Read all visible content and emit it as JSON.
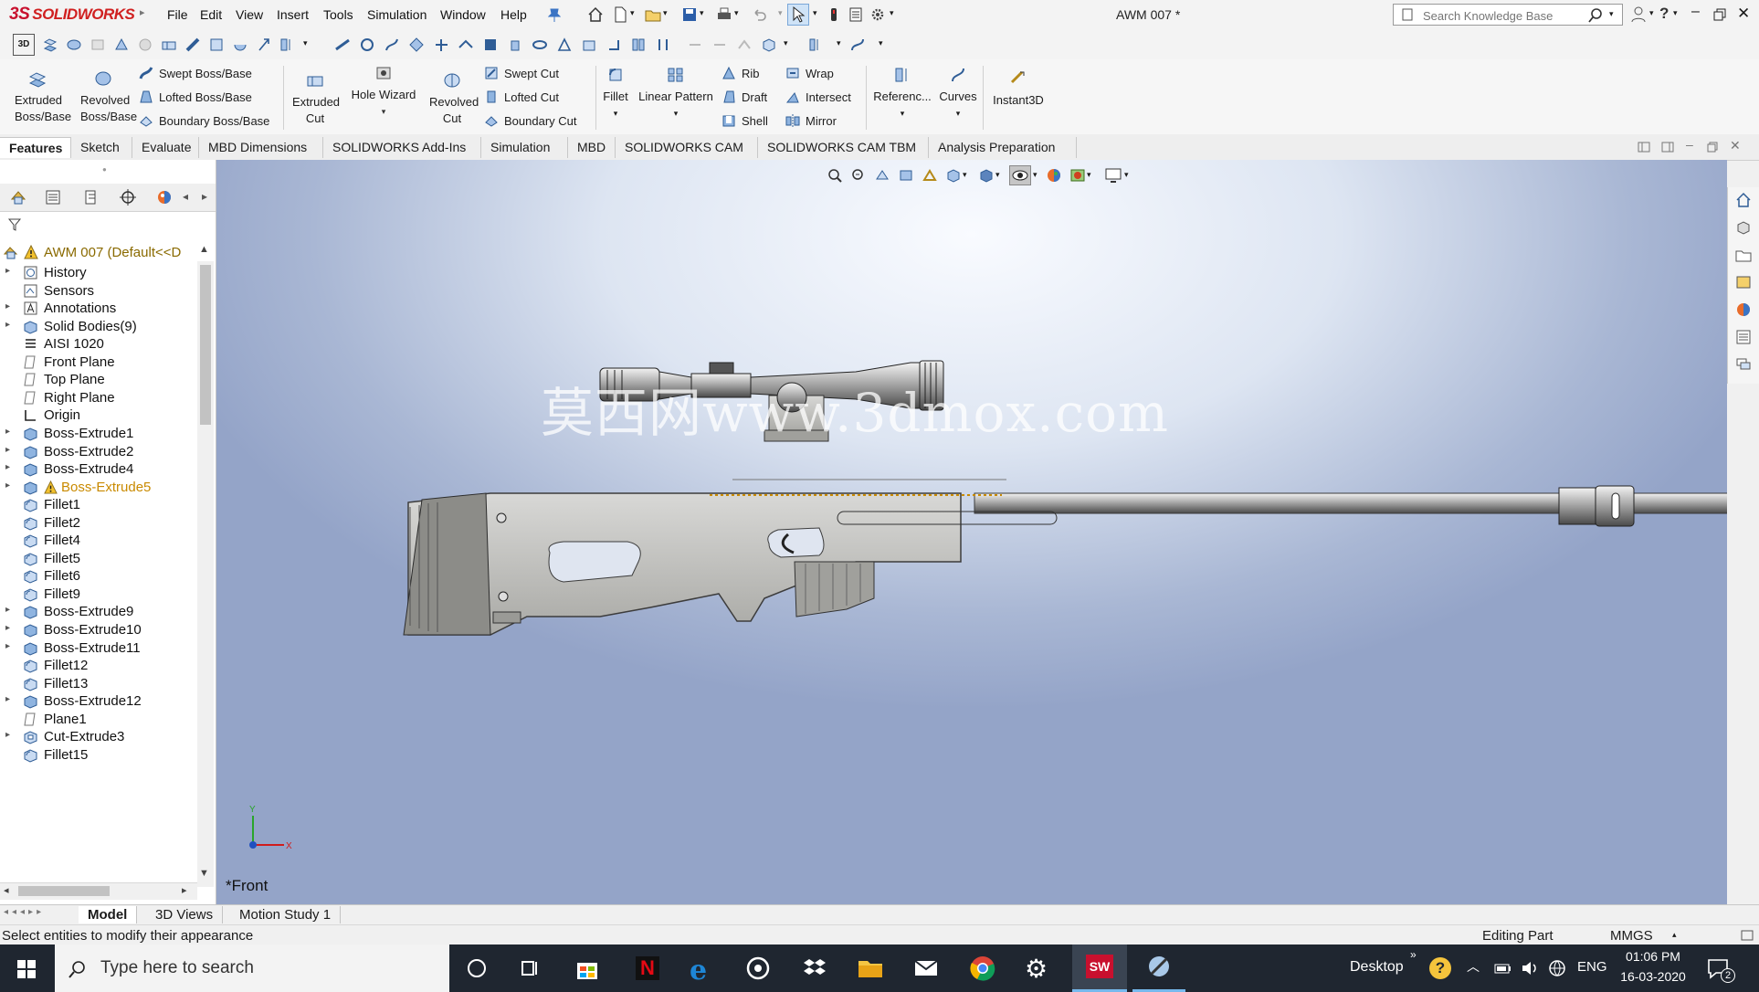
{
  "app": {
    "logo_text": "SOLIDWORKS",
    "logo_symbol": "3S",
    "document_title": "AWM 007 *"
  },
  "menu": [
    "File",
    "Edit",
    "View",
    "Insert",
    "Tools",
    "Simulation",
    "Window",
    "Help"
  ],
  "search": {
    "placeholder": "Search Knowledge Base"
  },
  "command_manager": {
    "extruded_boss": "Extruded Boss/Base",
    "revolved_boss": "Revolved Boss/Base",
    "swept_boss": "Swept Boss/Base",
    "lofted_boss": "Lofted Boss/Base",
    "boundary_boss": "Boundary Boss/Base",
    "extruded_cut": "Extruded Cut",
    "hole_wizard": "Hole Wizard",
    "revolved_cut": "Revolved Cut",
    "swept_cut": "Swept Cut",
    "lofted_cut": "Lofted Cut",
    "boundary_cut": "Boundary Cut",
    "fillet": "Fillet",
    "linear_pattern": "Linear Pattern",
    "rib": "Rib",
    "draft": "Draft",
    "shell": "Shell",
    "wrap": "Wrap",
    "intersect": "Intersect",
    "mirror": "Mirror",
    "reference": "Referenc...",
    "curves": "Curves",
    "instant3d": "Instant3D"
  },
  "tabs": [
    "Features",
    "Sketch",
    "Evaluate",
    "MBD Dimensions",
    "SOLIDWORKS Add-Ins",
    "Simulation",
    "MBD",
    "SOLIDWORKS CAM",
    "SOLIDWORKS CAM TBM",
    "Analysis Preparation"
  ],
  "feature_tree": {
    "root": "AWM 007  (Default<<D",
    "items": [
      {
        "label": "History",
        "icon": "history-icon",
        "expandable": true
      },
      {
        "label": "Sensors",
        "icon": "sensors-icon",
        "expandable": false
      },
      {
        "label": "Annotations",
        "icon": "annotations-icon",
        "expandable": true
      },
      {
        "label": "Solid Bodies(9)",
        "icon": "solid-bodies-icon",
        "expandable": true
      },
      {
        "label": "AISI 1020",
        "icon": "material-icon",
        "expandable": false
      },
      {
        "label": "Front Plane",
        "icon": "plane-icon",
        "expandable": false
      },
      {
        "label": "Top Plane",
        "icon": "plane-icon",
        "expandable": false
      },
      {
        "label": "Right Plane",
        "icon": "plane-icon",
        "expandable": false
      },
      {
        "label": "Origin",
        "icon": "origin-icon",
        "expandable": false
      },
      {
        "label": "Boss-Extrude1",
        "icon": "extrude-icon",
        "expandable": true
      },
      {
        "label": "Boss-Extrude2",
        "icon": "extrude-icon",
        "expandable": true
      },
      {
        "label": "Boss-Extrude4",
        "icon": "extrude-icon",
        "expandable": true
      },
      {
        "label": "Boss-Extrude5",
        "icon": "extrude-icon",
        "expandable": true,
        "warning": true
      },
      {
        "label": "Fillet1",
        "icon": "fillet-icon",
        "expandable": false
      },
      {
        "label": "Fillet2",
        "icon": "fillet-icon",
        "expandable": false
      },
      {
        "label": "Fillet4",
        "icon": "fillet-icon",
        "expandable": false
      },
      {
        "label": "Fillet5",
        "icon": "fillet-icon",
        "expandable": false
      },
      {
        "label": "Fillet6",
        "icon": "fillet-icon",
        "expandable": false
      },
      {
        "label": "Fillet9",
        "icon": "fillet-icon",
        "expandable": false
      },
      {
        "label": "Boss-Extrude9",
        "icon": "extrude-icon",
        "expandable": true
      },
      {
        "label": "Boss-Extrude10",
        "icon": "extrude-icon",
        "expandable": true
      },
      {
        "label": "Boss-Extrude11",
        "icon": "extrude-icon",
        "expandable": true
      },
      {
        "label": "Fillet12",
        "icon": "fillet-icon",
        "expandable": false
      },
      {
        "label": "Fillet13",
        "icon": "fillet-icon",
        "expandable": false
      },
      {
        "label": "Boss-Extrude12",
        "icon": "extrude-icon",
        "expandable": true
      },
      {
        "label": "Plane1",
        "icon": "plane-icon",
        "expandable": false
      },
      {
        "label": "Cut-Extrude3",
        "icon": "cut-extrude-icon",
        "expandable": true
      },
      {
        "label": "Fillet15",
        "icon": "fillet-icon",
        "expandable": false
      }
    ]
  },
  "viewport": {
    "view_label": "*Front",
    "watermark": "莫西网www.3dmox.com",
    "axis_y": "Y",
    "axis_x": "X"
  },
  "bottom_tabs": [
    "Model",
    "3D Views",
    "Motion Study 1"
  ],
  "status": {
    "message": "Select entities to modify their appearance",
    "mode": "Editing Part",
    "units": "MMGS"
  },
  "taskbar": {
    "search_placeholder": "Type here to search",
    "desktop": "Desktop",
    "language": "ENG",
    "time": "01:06 PM",
    "date": "16-03-2020",
    "notifications": "2"
  },
  "colors": {
    "accent_red": "#d02020",
    "warning_orange": "#c98a00",
    "taskbar": "#1f2630",
    "viewport_top": "#f9fbff",
    "viewport_bottom": "#94a4c8"
  }
}
